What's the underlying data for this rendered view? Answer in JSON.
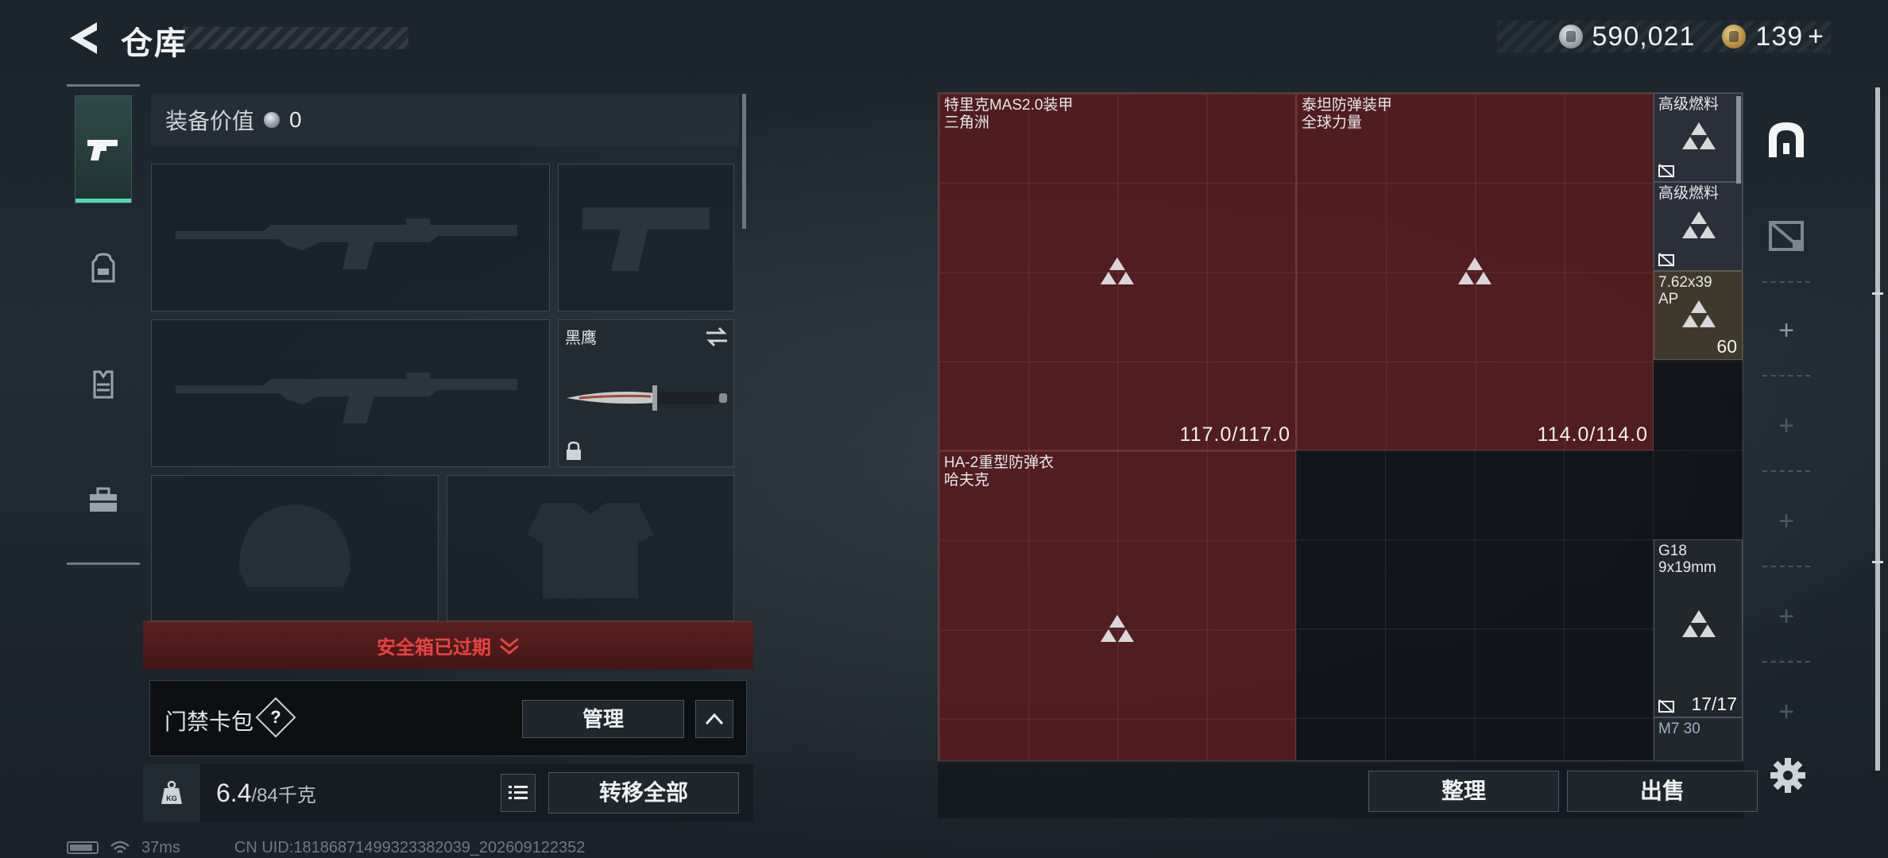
{
  "header": {
    "title": "仓库",
    "back_icon": "back-arrow-icon",
    "silver_currency": "590,021",
    "gold_currency": "139",
    "gold_plus": "+"
  },
  "nav": {
    "tabs": [
      {
        "icon": "pistol-icon",
        "active": true
      },
      {
        "icon": "backpack-icon",
        "active": false
      },
      {
        "icon": "vest-icon",
        "active": false
      },
      {
        "icon": "briefcase-icon",
        "active": false
      }
    ]
  },
  "equipment": {
    "value_label": "装备价值",
    "value": "0",
    "knife_slot_label": "黑鹰",
    "safebox_status": "安全箱已过期",
    "keycard_label": "门禁卡包",
    "help_label": "?",
    "manage_label": "管理",
    "capacity_current": "6.4",
    "capacity_max": "/84千克",
    "transfer_all_label": "转移全部"
  },
  "status_bar": {
    "ping": "37ms",
    "uid": "CN UID:18186871499323382039_202609122352"
  },
  "stash": {
    "items": [
      {
        "name": "特里克MAS2.0装甲",
        "sub": "三角洲",
        "durability": "117.0/117.0"
      },
      {
        "name": "泰坦防弹装甲",
        "sub": "全球力量",
        "durability": "114.0/114.0"
      },
      {
        "name": "HA-2重型防弹衣",
        "sub": "哈夫克",
        "durability": ""
      }
    ],
    "side_items": [
      {
        "name": "高级燃料",
        "count": ""
      },
      {
        "name": "高级燃料",
        "count": ""
      },
      {
        "name": "7.62x39 AP",
        "count": "60"
      },
      {
        "name": "G18 9x19mm",
        "count": "17/17"
      },
      {
        "name": "M7 30",
        "count": ""
      }
    ],
    "sort_label": "整理",
    "sell_label": "出售"
  },
  "colors": {
    "accent": "#57d6b7",
    "item_red": "#622022",
    "alert_red": "#e8433f"
  }
}
